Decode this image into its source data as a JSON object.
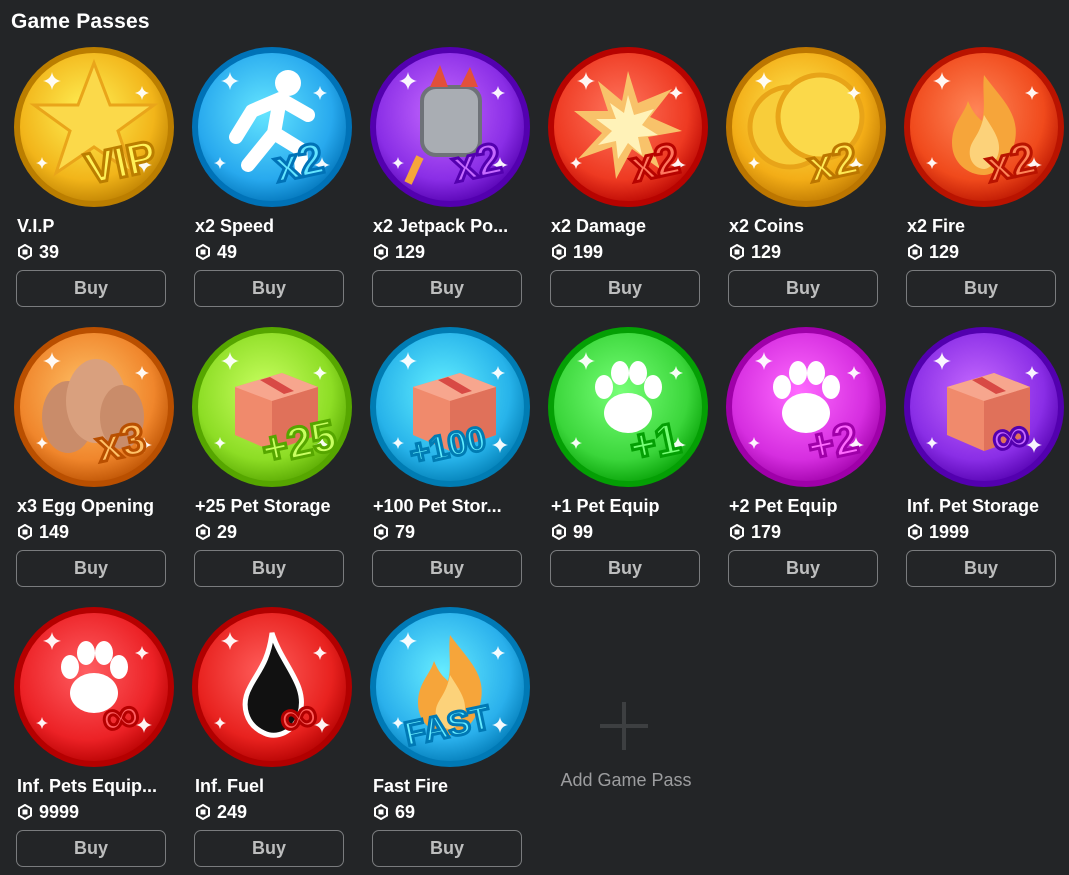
{
  "page": {
    "title": "Game Passes"
  },
  "passes": [
    {
      "name": "V.I.P",
      "price": "39",
      "buy_label": "Buy",
      "icon": "vip-star-badge-icon",
      "color": "#f2b51a",
      "overlay": "VIP"
    },
    {
      "name": "x2 Speed",
      "price": "49",
      "buy_label": "Buy",
      "icon": "running-figure-x2-icon",
      "color": "#28a9ee",
      "overlay": "x2"
    },
    {
      "name": "x2 Jetpack Po...",
      "price": "129",
      "buy_label": "Buy",
      "icon": "jetpack-x2-icon",
      "color": "#8a2ee6",
      "overlay": "x2"
    },
    {
      "name": "x2 Damage",
      "price": "199",
      "buy_label": "Buy",
      "icon": "explosion-x2-icon",
      "color": "#ee3a22",
      "overlay": "x2"
    },
    {
      "name": "x2 Coins",
      "price": "129",
      "buy_label": "Buy",
      "icon": "coins-x2-icon",
      "color": "#f3ad17",
      "overlay": "x2"
    },
    {
      "name": "x2 Fire",
      "price": "129",
      "buy_label": "Buy",
      "icon": "fire-x2-icon",
      "color": "#f04a1c",
      "overlay": "x2"
    },
    {
      "name": "x3 Egg Opening",
      "price": "149",
      "buy_label": "Buy",
      "icon": "eggs-x3-icon",
      "color": "#f0862c",
      "overlay": "x3"
    },
    {
      "name": "+25 Pet Storage",
      "price": "29",
      "buy_label": "Buy",
      "icon": "box-plus25-icon",
      "color": "#8ddd25",
      "overlay": "+25"
    },
    {
      "name": "+100 Pet Stor...",
      "price": "79",
      "buy_label": "Buy",
      "icon": "box-plus100-icon",
      "color": "#27b3ea",
      "overlay": "+100"
    },
    {
      "name": "+1 Pet Equip",
      "price": "99",
      "buy_label": "Buy",
      "icon": "paw-plus1-icon",
      "color": "#3bd63b",
      "overlay": "+1"
    },
    {
      "name": "+2 Pet Equip",
      "price": "179",
      "buy_label": "Buy",
      "icon": "paws-plus2-icon",
      "color": "#d62ee0",
      "overlay": "+2"
    },
    {
      "name": "Inf. Pet Storage",
      "price": "1999",
      "buy_label": "Buy",
      "icon": "box-infinity-icon",
      "color": "#8a2ee6",
      "overlay": "∞"
    },
    {
      "name": "Inf. Pets Equip...",
      "price": "9999",
      "buy_label": "Buy",
      "icon": "paws-infinity-icon",
      "color": "#ec2226",
      "overlay": "∞"
    },
    {
      "name": "Inf. Fuel",
      "price": "249",
      "buy_label": "Buy",
      "icon": "fuel-drop-infinity-icon",
      "color": "#e8221f",
      "overlay": "∞"
    },
    {
      "name": "Fast Fire",
      "price": "69",
      "buy_label": "Buy",
      "icon": "fast-fire-icon",
      "color": "#2ab0ec",
      "overlay": "FAST"
    }
  ],
  "add_game_pass": {
    "label": "Add Game Pass",
    "icon": "plus-icon"
  },
  "colors": {
    "background": "#232527",
    "button_border": "#7a7c7e",
    "button_text": "#bdbebe",
    "muted_text": "#9c9d9f"
  }
}
